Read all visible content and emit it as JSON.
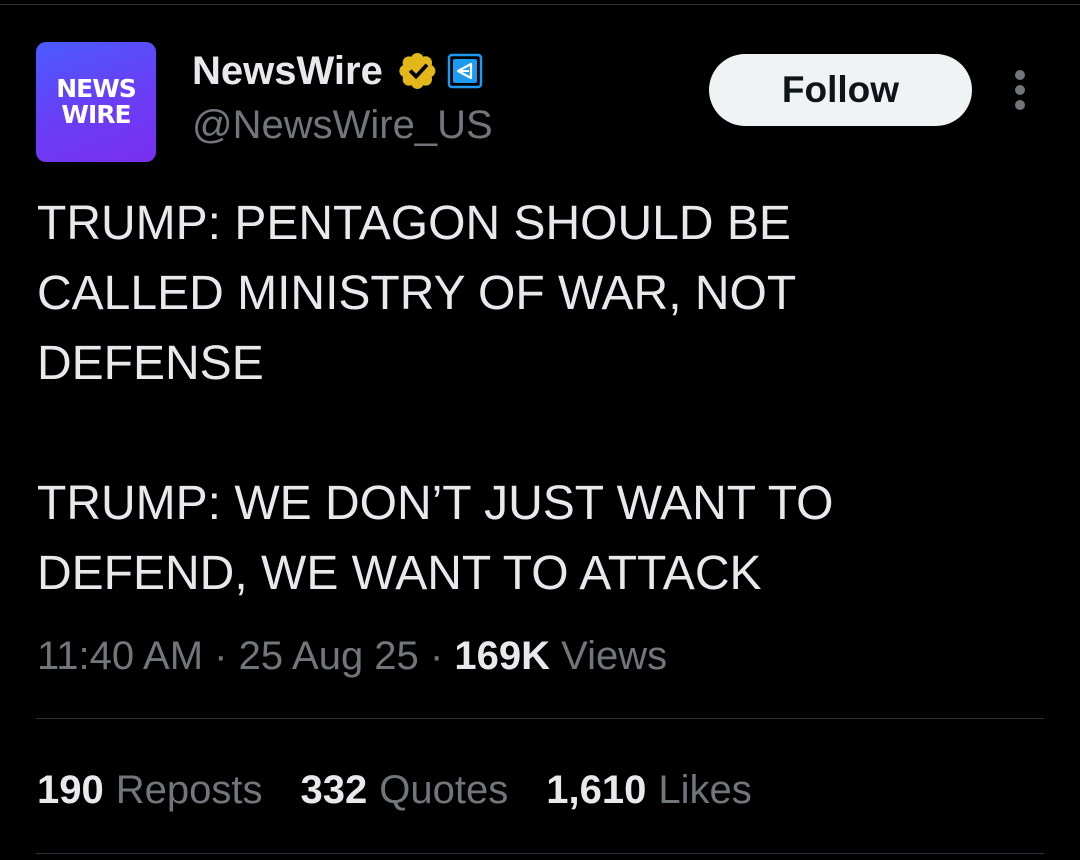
{
  "account": {
    "avatar_text_line1": "NEWS",
    "avatar_text_line2": "WIRE",
    "display_name": "NewsWire",
    "handle": "@NewsWire_US",
    "verified_icon": "gold-verified-badge-icon",
    "affiliate_icon": "affiliate-badge-icon",
    "verified_color": "#e2b719",
    "affiliate_color": "#1d9bf0"
  },
  "actions": {
    "follow_label": "Follow",
    "more_icon": "more-vertical-icon"
  },
  "tweet": {
    "text": "TRUMP: PENTAGON SHOULD BE\nCALLED MINISTRY OF WAR, NOT\nDEFENSE\n\nTRUMP: WE DON’T JUST WANT TO\nDEFEND, WE WANT TO ATTACK",
    "time": "11:40 AM",
    "separator": "·",
    "date": "25 Aug 25",
    "views_count": "169K",
    "views_label": "Views"
  },
  "stats": {
    "reposts_count": "190",
    "reposts_label": "Reposts",
    "quotes_count": "332",
    "quotes_label": "Quotes",
    "likes_count": "1,610",
    "likes_label": "Likes"
  },
  "colors": {
    "background": "#000000",
    "text_primary": "#e7e9ea",
    "text_secondary": "#71767b",
    "divider": "#2f3336",
    "avatar_gradient_start": "#4b5bff",
    "avatar_gradient_end": "#7a2ff0"
  }
}
